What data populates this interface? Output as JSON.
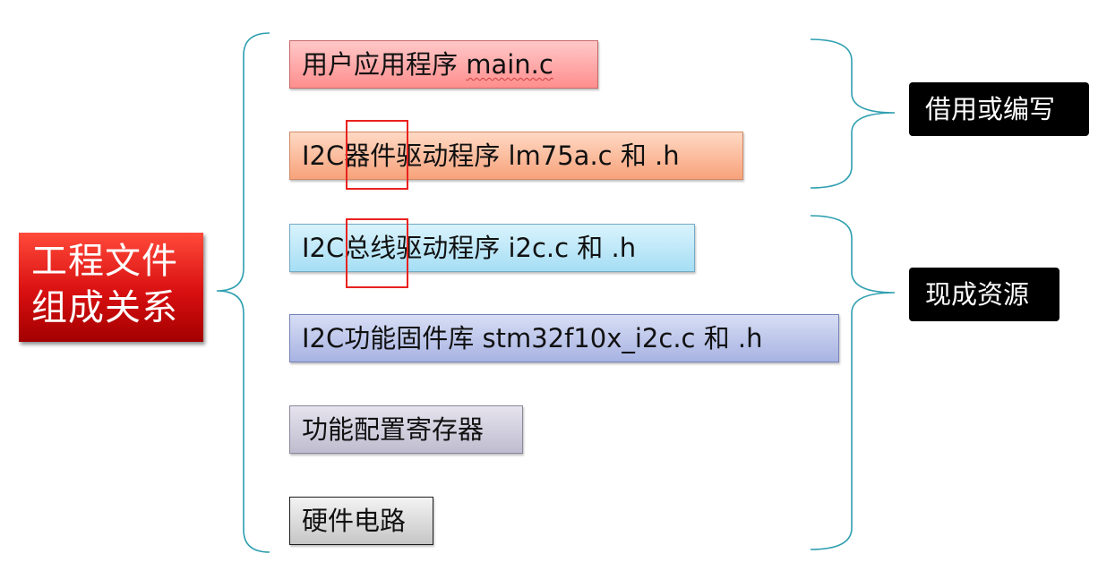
{
  "title": {
    "line1": "工程文件",
    "line2": "组成关系"
  },
  "layers": [
    {
      "prefix": "用户应用程序 ",
      "file": "main.c"
    },
    {
      "text": "I2C器件驱动程序 lm75a.c 和 .h"
    },
    {
      "text": "I2C总线驱动程序 i2c.c 和 .h"
    },
    {
      "text": "I2C功能固件库 stm32f10x_i2c.c 和 .h"
    },
    {
      "text": "功能配置寄存器"
    },
    {
      "text": "硬件电路"
    }
  ],
  "tags": {
    "borrow_or_write": "借用或编写",
    "existing_resources": "现成资源"
  },
  "colors": {
    "title_red": "#d80f10",
    "brace": "#2e9fb0",
    "highlight": "#e8221e"
  }
}
